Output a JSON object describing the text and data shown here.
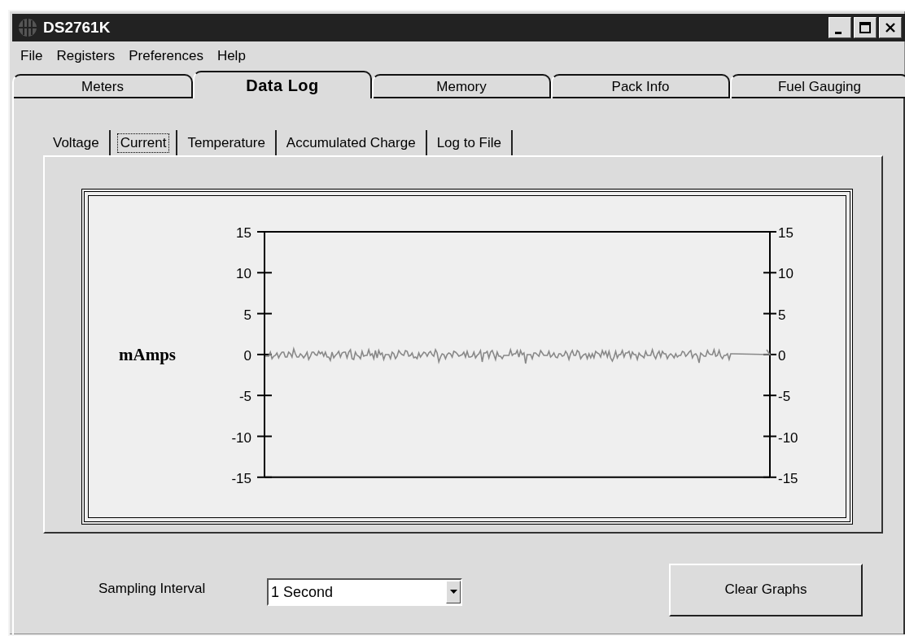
{
  "window": {
    "title": "DS2761K"
  },
  "menu": [
    "File",
    "Registers",
    "Preferences",
    "Help"
  ],
  "tabs": [
    {
      "label": "Meters",
      "selected": false
    },
    {
      "label": "Data Log",
      "selected": true
    },
    {
      "label": "Memory",
      "selected": false
    },
    {
      "label": "Pack Info",
      "selected": false
    },
    {
      "label": "Fuel Gauging",
      "selected": false
    }
  ],
  "subtabs": [
    {
      "label": "Voltage",
      "selected": false
    },
    {
      "label": "Current",
      "selected": true
    },
    {
      "label": "Temperature",
      "selected": false
    },
    {
      "label": "Accumulated Charge",
      "selected": false
    },
    {
      "label": "Log to File",
      "selected": false
    }
  ],
  "chart": {
    "ylabel": "mAmps",
    "left_ticks": [
      "15",
      "10",
      "5",
      "0",
      "-5",
      "-10",
      "-15"
    ],
    "right_ticks": [
      "15",
      "10",
      "5",
      "0",
      "-5",
      "-10",
      "-15"
    ]
  },
  "sampling": {
    "label": "Sampling Interval",
    "value": "1 Second"
  },
  "buttons": [
    "Clear Graphs"
  ]
}
